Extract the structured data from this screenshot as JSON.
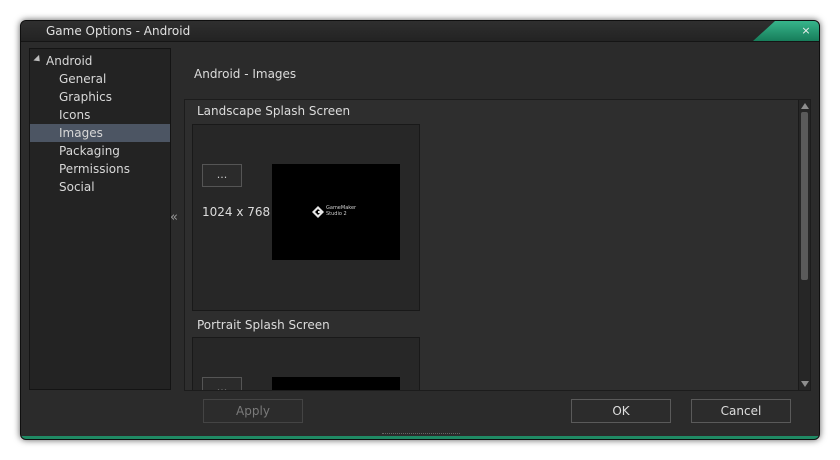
{
  "window": {
    "title": "Game Options - Android",
    "close_glyph": "×",
    "accent_color": "#2ea77a"
  },
  "sidebar": {
    "root_label": "Android",
    "items": [
      {
        "label": "General"
      },
      {
        "label": "Graphics"
      },
      {
        "label": "Icons"
      },
      {
        "label": "Images",
        "selected": true
      },
      {
        "label": "Packaging"
      },
      {
        "label": "Permissions"
      },
      {
        "label": "Social"
      }
    ],
    "collapse_glyph": "«"
  },
  "main": {
    "section_title": "Android - Images",
    "landscape": {
      "label": "Landscape Splash Screen",
      "browse_label": "...",
      "dimensions": "1024 x 768",
      "logo_text": [
        "GameMaker",
        "Studio 2"
      ]
    },
    "portrait": {
      "label": "Portrait Splash Screen",
      "browse_label": "..."
    }
  },
  "footer": {
    "apply_label": "Apply",
    "ok_label": "OK",
    "cancel_label": "Cancel"
  }
}
